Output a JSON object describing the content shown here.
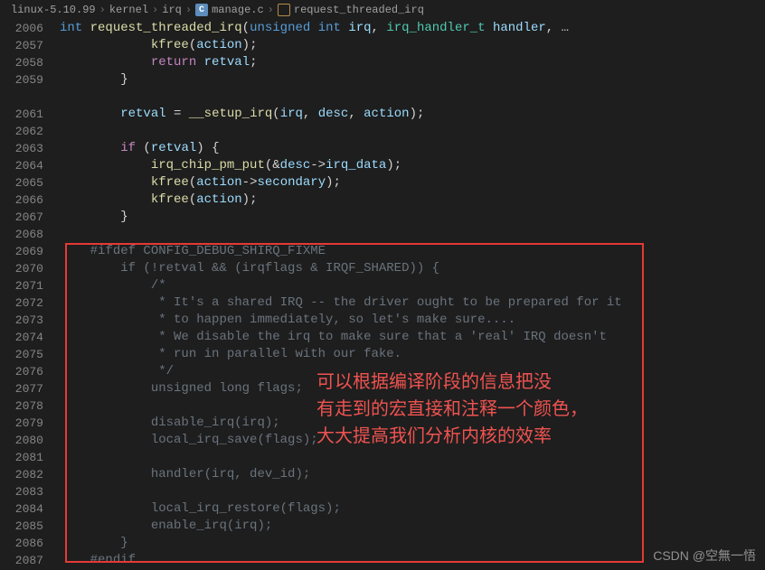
{
  "breadcrumb": {
    "seg1": "linux-5.10.99",
    "seg2": "kernel",
    "seg3": "irq",
    "seg4": "manage.c",
    "seg5": "request_threaded_irq"
  },
  "signature": {
    "ln": "2006",
    "kw_int": "int",
    "fn_name": "request_threaded_irq",
    "p_open": "(",
    "kw_unsigned": "unsigned",
    "kw_int2": "int",
    "p_irq": "irq",
    "comma1": ", ",
    "t_handler": "irq_handler_t",
    "p_handler": "handler",
    "comma2": ",",
    "cont": "…"
  },
  "lines": [
    {
      "num": "2057",
      "html": "            <span class='fn'>kfree</span>(<span class='var'>action</span>);"
    },
    {
      "num": "2058",
      "html": "            <span class='ctl'>return</span> <span class='var'>retval</span>;"
    },
    {
      "num": "2059",
      "html": "        }"
    },
    {
      "num": "    ",
      "html": ""
    },
    {
      "num": "2061",
      "html": "        <span class='var'>retval</span> = <span class='fn'>__setup_irq</span>(<span class='var'>irq</span>, <span class='var'>desc</span>, <span class='var'>action</span>);"
    },
    {
      "num": "2062",
      "html": ""
    },
    {
      "num": "2063",
      "html": "        <span class='ctl'>if</span> (<span class='var'>retval</span>) {"
    },
    {
      "num": "2064",
      "html": "            <span class='fn'>irq_chip_pm_put</span>(&<span class='var'>desc</span>-><span class='var'>irq_data</span>);"
    },
    {
      "num": "2065",
      "html": "            <span class='fn'>kfree</span>(<span class='var'>action</span>-><span class='var'>secondary</span>);"
    },
    {
      "num": "2066",
      "html": "            <span class='fn'>kfree</span>(<span class='var'>action</span>);"
    },
    {
      "num": "2067",
      "html": "        }"
    },
    {
      "num": "2068",
      "html": ""
    },
    {
      "num": "2069",
      "html": "    <span class='dim'>#ifdef CONFIG_DEBUG_SHIRQ_FIXME</span>"
    },
    {
      "num": "2070",
      "html": "        <span class='dim'>if (!retval && (irqflags & IRQF_SHARED)) {</span>"
    },
    {
      "num": "2071",
      "html": "            <span class='dim'>/*</span>"
    },
    {
      "num": "2072",
      "html": "            <span class='dim'> * It's a shared IRQ -- the driver ought to be prepared for it</span>"
    },
    {
      "num": "2073",
      "html": "            <span class='dim'> * to happen immediately, so let's make sure....</span>"
    },
    {
      "num": "2074",
      "html": "            <span class='dim'> * We disable the irq to make sure that a 'real' IRQ doesn't</span>"
    },
    {
      "num": "2075",
      "html": "            <span class='dim'> * run in parallel with our fake.</span>"
    },
    {
      "num": "2076",
      "html": "            <span class='dim'> */</span>"
    },
    {
      "num": "2077",
      "html": "            <span class='dim'>unsigned long flags;</span>"
    },
    {
      "num": "2078",
      "html": ""
    },
    {
      "num": "2079",
      "html": "            <span class='dim'>disable_irq(irq);</span>"
    },
    {
      "num": "2080",
      "html": "            <span class='dim'>local_irq_save(flags);</span>"
    },
    {
      "num": "2081",
      "html": ""
    },
    {
      "num": "2082",
      "html": "            <span class='dim'>handler(irq, dev_id);</span>"
    },
    {
      "num": "2083",
      "html": ""
    },
    {
      "num": "2084",
      "html": "            <span class='dim'>local_irq_restore(flags);</span>"
    },
    {
      "num": "2085",
      "html": "            <span class='dim'>enable_irq(irq);</span>"
    },
    {
      "num": "2086",
      "html": "        <span class='dim'>}</span>"
    },
    {
      "num": "2087",
      "html": "    <span class='dim'>#endif</span>"
    }
  ],
  "annotation": {
    "l1": "可以根据编译阶段的信息把没",
    "l2": "有走到的宏直接和注释一个颜色，",
    "l3": "大大提高我们分析内核的效率"
  },
  "watermark": "CSDN @空無一悟"
}
